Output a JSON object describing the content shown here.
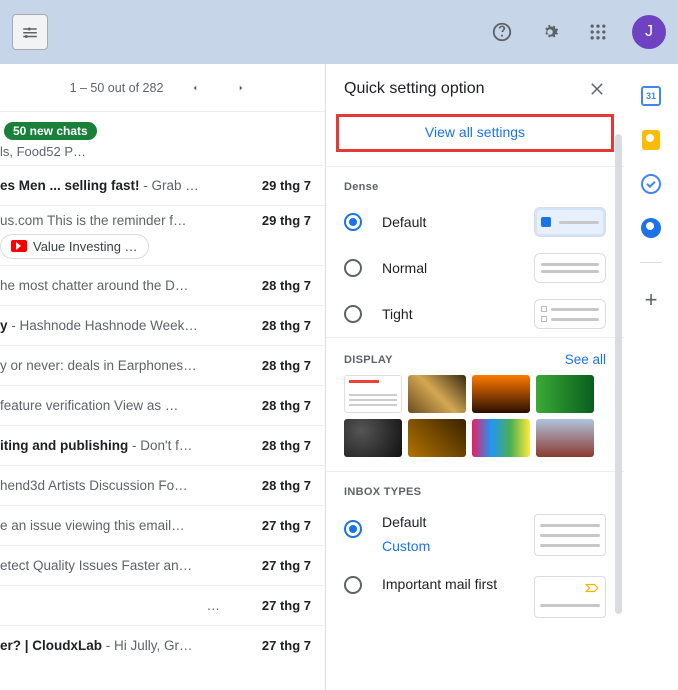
{
  "topbar": {
    "avatar_initial": "J"
  },
  "mail": {
    "pagination": "1 – 50 out of 282",
    "badge": "50 new chats",
    "badge_sub": "ls, Food52 P…",
    "rows": [
      {
        "text_bold": "es Men ... selling fast!",
        "text_light": " - Grab …",
        "date": "29 thg 7",
        "unread": true
      },
      {
        "text_bold": "",
        "text_light": "us.com This is the reminder f…",
        "date": "29 thg 7",
        "unread": false,
        "chip": "Value Investing …"
      },
      {
        "text_bold": "",
        "text_light": "he most chatter around the D…",
        "date": "28 thg 7",
        "unread": false
      },
      {
        "text_bold": "y",
        "text_light": " - Hashnode Hashnode Week…",
        "date": "28 thg 7",
        "unread": true
      },
      {
        "text_bold": "",
        "text_light": "y or never: deals in Earphones…",
        "date": "28 thg 7",
        "unread": false
      },
      {
        "text_bold": "",
        "text_light": " feature verification View as …",
        "date": "28 thg 7",
        "unread": false
      },
      {
        "text_bold": "iting and publishing",
        "text_light": " - Don't f…",
        "date": "28 thg 7",
        "unread": true
      },
      {
        "text_bold": "",
        "text_light": "hend3d Artists Discussion Fo…",
        "date": "28 thg 7",
        "unread": false
      },
      {
        "text_bold": "",
        "text_light": "e an issue viewing this email…",
        "date": "27 thg 7",
        "unread": false
      },
      {
        "text_bold": "",
        "text_light": "etect Quality Issues Faster an…",
        "date": "27 thg 7",
        "unread": false
      },
      {
        "text_bold": "",
        "text_light": "…",
        "date": "27 thg 7",
        "unread": false
      },
      {
        "text_bold": "er? | CloudxLab",
        "text_light": " - Hi Jully, Gr…",
        "date": "27 thg 7",
        "unread": true
      }
    ]
  },
  "panel": {
    "title": "Quick setting option",
    "view_all": "View all settings",
    "dense_label": "Dense",
    "density": [
      {
        "label": "Default",
        "checked": true
      },
      {
        "label": "Normal",
        "checked": false
      },
      {
        "label": "Tight",
        "checked": false
      }
    ],
    "display_label": "DISPLAY",
    "see_all": "See all",
    "inbox_types_label": "INBOX TYPES",
    "inbox": {
      "default_label": "Default",
      "custom_label": "Custom",
      "important_label": "Important mail first"
    }
  }
}
